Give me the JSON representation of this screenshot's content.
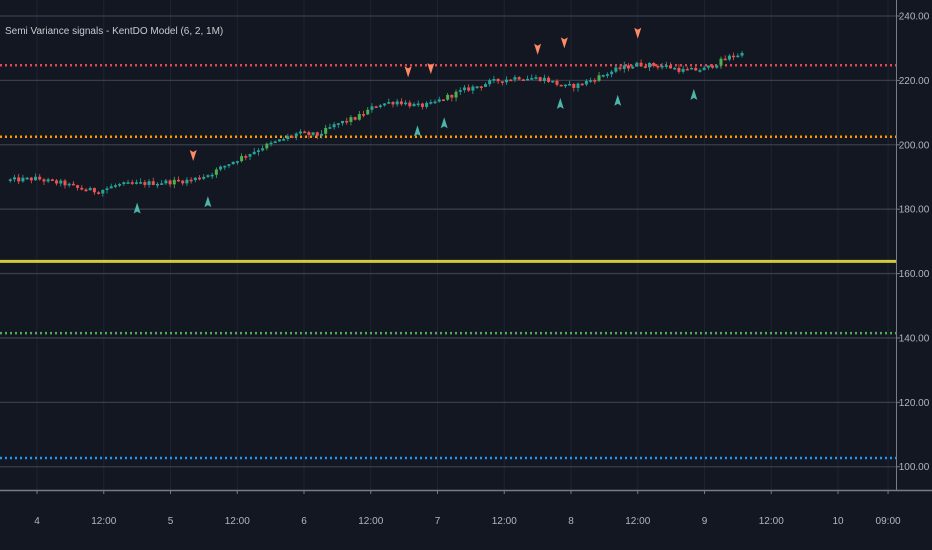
{
  "indicator": {
    "title": "Semi Variance signals - KentDO Model (6, 2, 1M)"
  },
  "colors": {
    "background": "#131722",
    "grid_h": "#3a3e4c",
    "grid_v": "#1f2330",
    "up_candle": "#26a69a",
    "up_candle_bright": "#4caf50",
    "down_candle": "#ef5350",
    "buy_signal": "#4db6ac",
    "sell_signal": "#ff8a65",
    "level_red": "#e0464f",
    "level_orange": "#ff9800",
    "level_yellow": "#d4c93a",
    "level_green": "#4caf50",
    "level_blue": "#2196f3"
  },
  "chart_data": {
    "type": "candlestick",
    "ylim": [
      95,
      242
    ],
    "y_ticks": [
      100,
      120,
      140,
      160,
      180,
      200,
      220,
      240
    ],
    "y_tick_labels": [
      "100.00",
      "120.00",
      "140.00",
      "160.00",
      "180.00",
      "200.00",
      "220.00",
      "240.00"
    ],
    "x_range": [
      -0.2,
      6.48
    ],
    "x_ticks": [
      0,
      0.5,
      1,
      1.5,
      2,
      2.5,
      3,
      3.5,
      4,
      4.5,
      5,
      5.5,
      6,
      6.375
    ],
    "x_tick_labels": [
      "4",
      "12:00",
      "5",
      "12:00",
      "6",
      "12:00",
      "7",
      "12:00",
      "8",
      "12:00",
      "9",
      "12:00",
      "10",
      "09:00"
    ],
    "horizontal_levels": [
      {
        "value": 224.7,
        "style": "dotted",
        "color_key": "level_red"
      },
      {
        "value": 202.5,
        "style": "dotted",
        "color_key": "level_orange"
      },
      {
        "value": 163.8,
        "style": "solid",
        "color_key": "level_yellow"
      },
      {
        "value": 141.5,
        "style": "dotted",
        "color_key": "level_green"
      },
      {
        "value": 102.7,
        "style": "dotted",
        "color_key": "level_blue"
      }
    ],
    "anchors": [
      [
        -0.2,
        189.0
      ],
      [
        0.0,
        189.5
      ],
      [
        0.1,
        188.5
      ],
      [
        0.2,
        188.0
      ],
      [
        0.3,
        186.5
      ],
      [
        0.45,
        185.5
      ],
      [
        0.6,
        187.5
      ],
      [
        0.8,
        188.0
      ],
      [
        1.0,
        188.5
      ],
      [
        1.15,
        189.0
      ],
      [
        1.3,
        191.0
      ],
      [
        1.45,
        194.5
      ],
      [
        1.6,
        197.5
      ],
      [
        1.7,
        199.5
      ],
      [
        1.8,
        201.0
      ],
      [
        1.95,
        203.5
      ],
      [
        2.1,
        203.0
      ],
      [
        2.25,
        206.5
      ],
      [
        2.4,
        208.5
      ],
      [
        2.55,
        212.5
      ],
      [
        2.7,
        213.5
      ],
      [
        2.85,
        212.0
      ],
      [
        2.95,
        212.5
      ],
      [
        3.05,
        214.5
      ],
      [
        3.2,
        217.0
      ],
      [
        3.4,
        219.5
      ],
      [
        3.6,
        221.0
      ],
      [
        3.8,
        220.5
      ],
      [
        3.95,
        218.0
      ],
      [
        4.05,
        218.5
      ],
      [
        4.2,
        221.0
      ],
      [
        4.35,
        223.5
      ],
      [
        4.5,
        225.0
      ],
      [
        4.7,
        224.5
      ],
      [
        4.85,
        223.0
      ],
      [
        5.0,
        223.5
      ],
      [
        5.1,
        225.5
      ],
      [
        5.2,
        227.5
      ],
      [
        5.3,
        228.5
      ]
    ],
    "buy_signals": [
      {
        "x": 0.75,
        "y": 180.5
      },
      {
        "x": 1.28,
        "y": 182.5
      },
      {
        "x": 2.85,
        "y": 204.5
      },
      {
        "x": 3.05,
        "y": 207.0
      },
      {
        "x": 3.92,
        "y": 213.0
      },
      {
        "x": 4.35,
        "y": 214.0
      },
      {
        "x": 4.92,
        "y": 215.8
      }
    ],
    "sell_signals": [
      {
        "x": 1.17,
        "y": 196.5
      },
      {
        "x": 2.78,
        "y": 222.5
      },
      {
        "x": 2.95,
        "y": 223.5
      },
      {
        "x": 3.75,
        "y": 229.5
      },
      {
        "x": 3.95,
        "y": 231.5
      },
      {
        "x": 4.5,
        "y": 234.5
      }
    ]
  }
}
